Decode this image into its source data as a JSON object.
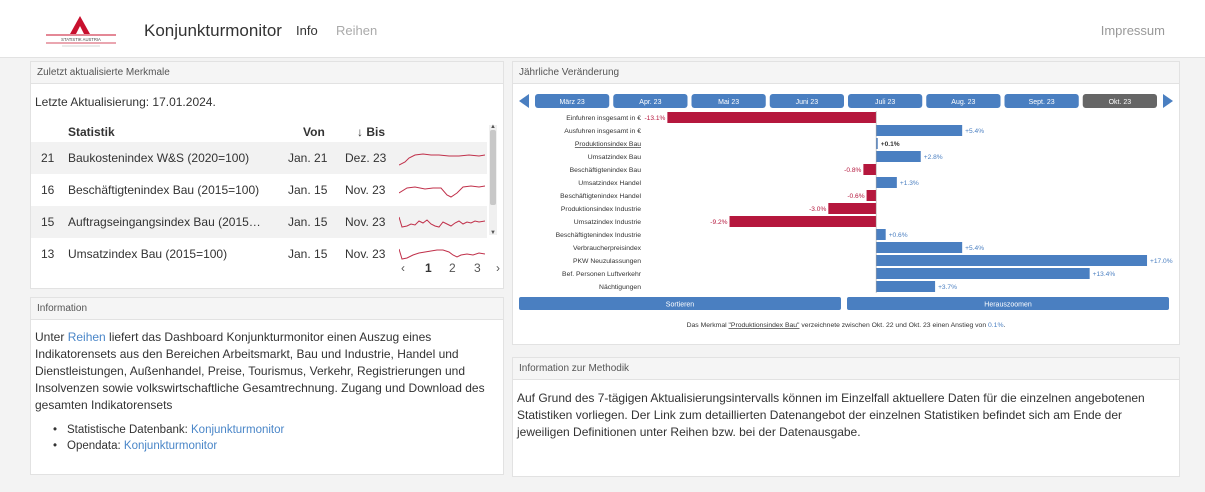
{
  "nav": {
    "brand": "Konjunkturmonitor",
    "info": "Info",
    "reihen": "Reihen",
    "impressum": "Impressum",
    "logo_text": "STATISTIK AUSTRIA"
  },
  "recent": {
    "panel_title": "Zuletzt aktualisierte Merkmale",
    "last_update": "Letzte Aktualisierung: 17.01.2024.",
    "headers": {
      "statistik": "Statistik",
      "von": "Von",
      "bis": "↓ Bis"
    },
    "rows": [
      {
        "nr": "21",
        "statistik": "Baukostenindex W&S (2020=100)",
        "von": "Jan. 21",
        "bis": "Dez. 23"
      },
      {
        "nr": "16",
        "statistik": "Beschäftigtenindex Bau (2015=100)",
        "von": "Jan. 15",
        "bis": "Nov. 23"
      },
      {
        "nr": "15",
        "statistik": "Auftragseingangsindex Bau (2015…",
        "von": "Jan. 15",
        "bis": "Nov. 23"
      },
      {
        "nr": "13",
        "statistik": "Umsatzindex Bau (2015=100)",
        "von": "Jan. 15",
        "bis": "Nov. 23"
      }
    ],
    "pager": {
      "prev": "‹",
      "pages": [
        "1",
        "2",
        "3"
      ],
      "next": "›",
      "active": "1"
    }
  },
  "info": {
    "panel_title": "Information",
    "text_1": "Unter ",
    "link_reihen": "Reihen",
    "text_2": " liefert das Dashboard Konjunkturmonitor einen Auszug eines Indikatorensets aus den Bereichen Arbeitsmarkt, Bau und Industrie, Handel und Dienstleistungen, Außenhandel, Preise, Tourismus, Verkehr, Registrierungen und Insolvenzen sowie volkswirtschaftliche Gesamtrechnung. Zugang und Download des gesamten Indikatorensets",
    "bullet_1_label": "Statistische Datenbank: ",
    "bullet_1_link": "Konjunkturmonitor",
    "bullet_2_label": "Opendata: ",
    "bullet_2_link": "Konjunkturmonitor"
  },
  "chart_panel": {
    "panel_title": "Jährliche Veränderung",
    "months": [
      "März 23",
      "Apr. 23",
      "Mai 23",
      "Juni 23",
      "Juli 23",
      "Aug. 23",
      "Sept. 23",
      "Okt. 23"
    ],
    "active_month": "Okt. 23",
    "sort_button": "Sortieren",
    "zoom_button": "Herauszoomen",
    "footer_prefix": "Das Merkmal ",
    "footer_link": "\"Produktionsindex Bau\"",
    "footer_mid": " verzeichnete zwischen Okt. 22 und Okt. 23 einen Anstieg von ",
    "footer_value": "0.1%",
    "footer_end": "."
  },
  "chart_data": {
    "type": "bar",
    "orientation": "horizontal",
    "categories": [
      "Einfuhren insgesamt in €",
      "Ausfuhren insgesamt in €",
      "Produktionsindex Bau",
      "Umsatzindex Bau",
      "Beschäftigtenindex Bau",
      "Umsatzindex Handel",
      "Beschäftigtenindex Handel",
      "Produktionsindex Industrie",
      "Umsatzindex Industrie",
      "Beschäftigtenindex Industrie",
      "Verbraucherpreisindex",
      "PKW Neuzulassungen",
      "Bef. Personen Luftverkehr",
      "Nächtigungen"
    ],
    "values": [
      -13.1,
      5.4,
      0.1,
      2.8,
      -0.8,
      1.3,
      -0.6,
      -3.0,
      -9.2,
      0.6,
      5.4,
      17.0,
      13.4,
      3.7
    ],
    "labels": [
      "-13.1%",
      "+5.4%",
      "+0.1%",
      "+2.8%",
      "-0.8%",
      "+1.3%",
      "-0.6%",
      "-3.0%",
      "-9.2%",
      "+0.6%",
      "+5.4%",
      "+17.0%",
      "+13.4%",
      "+3.7%"
    ],
    "highlighted": "Produktionsindex Bau",
    "colors": {
      "positive": "#4a7fc1",
      "negative": "#b5173d"
    },
    "xlim": [
      -13.5,
      17.5
    ]
  },
  "method": {
    "panel_title": "Information zur Methodik",
    "text": "Auf Grund des 7-tägigen Aktualisierungsintervalls können im Einzelfall aktuellere Daten für die einzelnen angebotenen Statistiken vorliegen. Der Link zum detaillierten Datenangebot der einzelnen Statistiken befindet sich am Ende der jeweiligen Definitionen unter Reihen bzw. bei der Datenausgabe."
  }
}
